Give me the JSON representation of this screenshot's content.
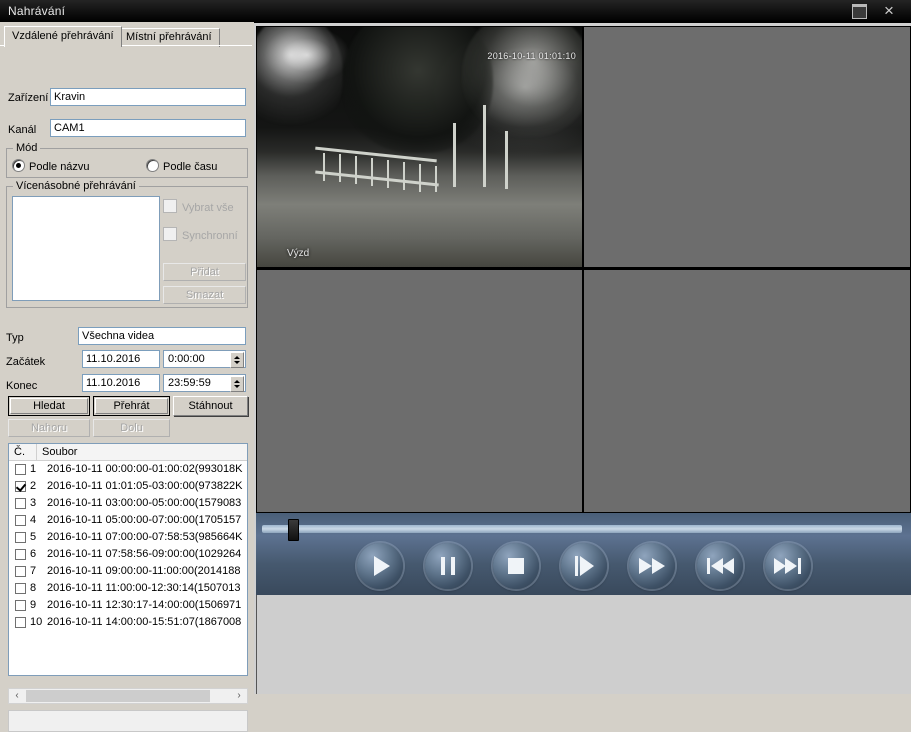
{
  "window": {
    "title": "Nahrávání",
    "minimize_label": "Minimalizovat",
    "close_label": "×"
  },
  "tabs": [
    {
      "label": "Vzdálené přehrávání",
      "active": true
    },
    {
      "label": "Místní přehrávání",
      "active": false
    }
  ],
  "form": {
    "device_label": "Zařízení",
    "device_value": "Kravin",
    "channel_label": "Kanál",
    "channel_value": "CAM1",
    "mode_group_label": "Mód",
    "mode_by_name": "Podle názvu",
    "mode_by_time": "Podle času",
    "multi_group_label": "Vícenásobné přehrávání",
    "select_all_label": "Vybrat vše",
    "sync_label": "Synchronní",
    "add_label": "Přidat",
    "delete_label": "Smazat",
    "type_label": "Typ",
    "type_value": "Všechna videa",
    "start_label": "Začátek",
    "start_date": "11.10.2016",
    "start_time": "0:00:00",
    "end_label": "Konec",
    "end_date": "11.10.2016",
    "end_time": "23:59:59",
    "search_button": "Hledat",
    "play_button": "Přehrát",
    "download_button": "Stáhnout",
    "up_button": "Nahoru",
    "down_button": "Dolu"
  },
  "file_table": {
    "columns": [
      "Č.",
      "Soubor"
    ],
    "rows": [
      {
        "checked": false,
        "num": "1",
        "file": "2016-10-11 00:00:00-01:00:02(993018K"
      },
      {
        "checked": true,
        "num": "2",
        "file": "2016-10-11 01:01:05-03:00:00(973822K"
      },
      {
        "checked": false,
        "num": "3",
        "file": "2016-10-11 03:00:00-05:00:00(1579083"
      },
      {
        "checked": false,
        "num": "4",
        "file": "2016-10-11 05:00:00-07:00:00(1705157"
      },
      {
        "checked": false,
        "num": "5",
        "file": "2016-10-11 07:00:00-07:58:53(985664K"
      },
      {
        "checked": false,
        "num": "6",
        "file": "2016-10-11 07:58:56-09:00:00(1029264"
      },
      {
        "checked": false,
        "num": "7",
        "file": "2016-10-11 09:00:00-11:00:00(2014188"
      },
      {
        "checked": false,
        "num": "8",
        "file": "2016-10-11 11:00:00-12:30:14(1507013"
      },
      {
        "checked": false,
        "num": "9",
        "file": "2016-10-11 12:30:17-14:00:00(1506971"
      },
      {
        "checked": false,
        "num": "10",
        "file": "2016-10-11 14:00:00-15:51:07(1867008"
      }
    ]
  },
  "video": {
    "osd_timestamp": "2016-10-11 01:01:10",
    "channel_label": "Výzd",
    "active_cell_index": 0,
    "active_border_color": "#1faa1f"
  },
  "transport": {
    "progress_percent": 4,
    "buttons": [
      {
        "name": "play",
        "label": "Přehrát"
      },
      {
        "name": "pause",
        "label": "Pozastavit"
      },
      {
        "name": "stop",
        "label": "Zastavit"
      },
      {
        "name": "slow-play",
        "label": "Po snímcích"
      },
      {
        "name": "fast-forward",
        "label": "Zrychleně"
      },
      {
        "name": "previous",
        "label": "Předchozí"
      },
      {
        "name": "next",
        "label": "Další"
      }
    ]
  },
  "scrollbar": {
    "left_arrow": "‹",
    "right_arrow": "›"
  }
}
